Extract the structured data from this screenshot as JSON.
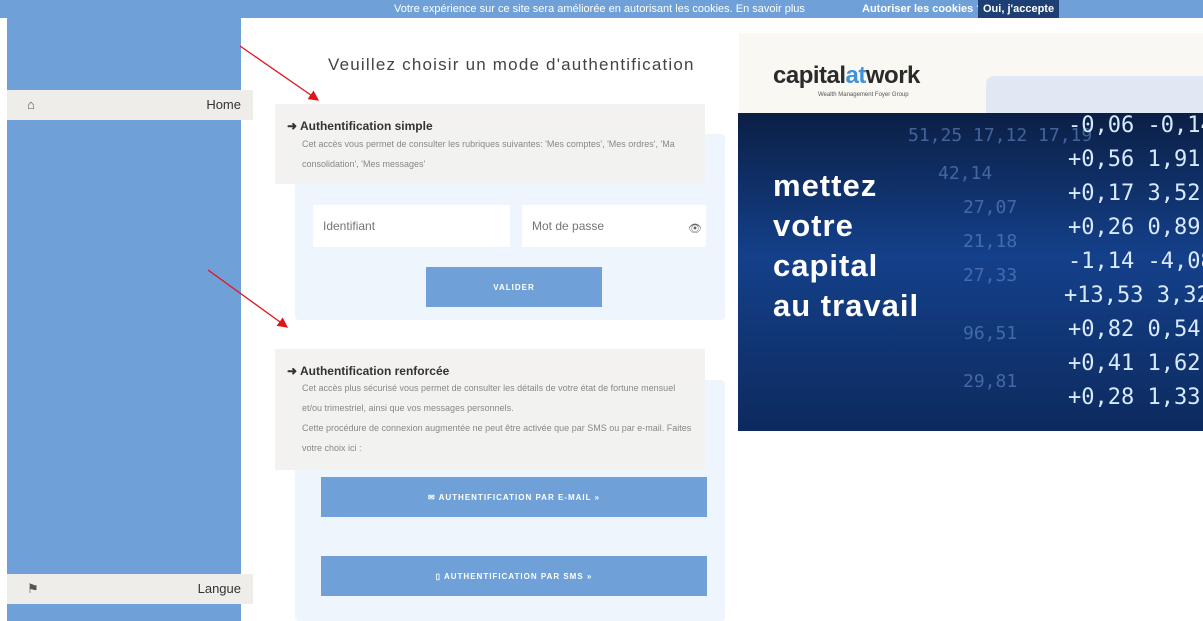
{
  "cookie_bar": {
    "message": "Votre expérience sur ce site sera améliorée en autorisant les cookies. En savoir plus",
    "allow_question": "Autoriser les cookies ?",
    "accept_label": "Oui, j'accepte"
  },
  "sidebar": {
    "home": {
      "icon": "home-icon",
      "label": "Home"
    },
    "language": {
      "icon": "flag-icon",
      "label": "Langue"
    }
  },
  "page_title": "Veuillez choisir un mode d'authentification",
  "simple_auth": {
    "heading": "Authentification simple",
    "description_line1": "Cet accès vous permet de consulter les rubriques suivantes: 'Mes comptes', 'Mes ordres', 'Ma",
    "description_line2": "consolidation', 'Mes messages'",
    "username_placeholder": "Identifiant",
    "password_placeholder": "Mot de passe",
    "submit_label": "VALIDER"
  },
  "strong_auth": {
    "heading": "Authentification renforcée",
    "description_line1": "Cet accès plus sécurisé vous permet de consulter les détails de votre état de fortune mensuel",
    "description_line2": "et/ou trimestriel, ainsi que vos messages personnels.",
    "description_line3": "Cette procédure de connexion augmentée ne peut être activée que par SMS ou par e-mail. Faites",
    "description_line4": "votre choix ici :",
    "email_button_label": "AUTHENTIFICATION PAR E-MAIL »",
    "sms_button_label": "AUTHENTIFICATION PAR SMS »"
  },
  "logo": {
    "capital": "capital",
    "at": "at",
    "work": "work",
    "subtitle": "Wealth Management  Foyer Group"
  },
  "banner": {
    "slogan_line1": "mettez",
    "slogan_line2": "votre",
    "slogan_line3": "capital",
    "slogan_line4": "au travail"
  },
  "colors": {
    "accent_blue": "#6fa1d8",
    "accept_button": "#1e3f74",
    "arrow_red": "#e0141c"
  }
}
